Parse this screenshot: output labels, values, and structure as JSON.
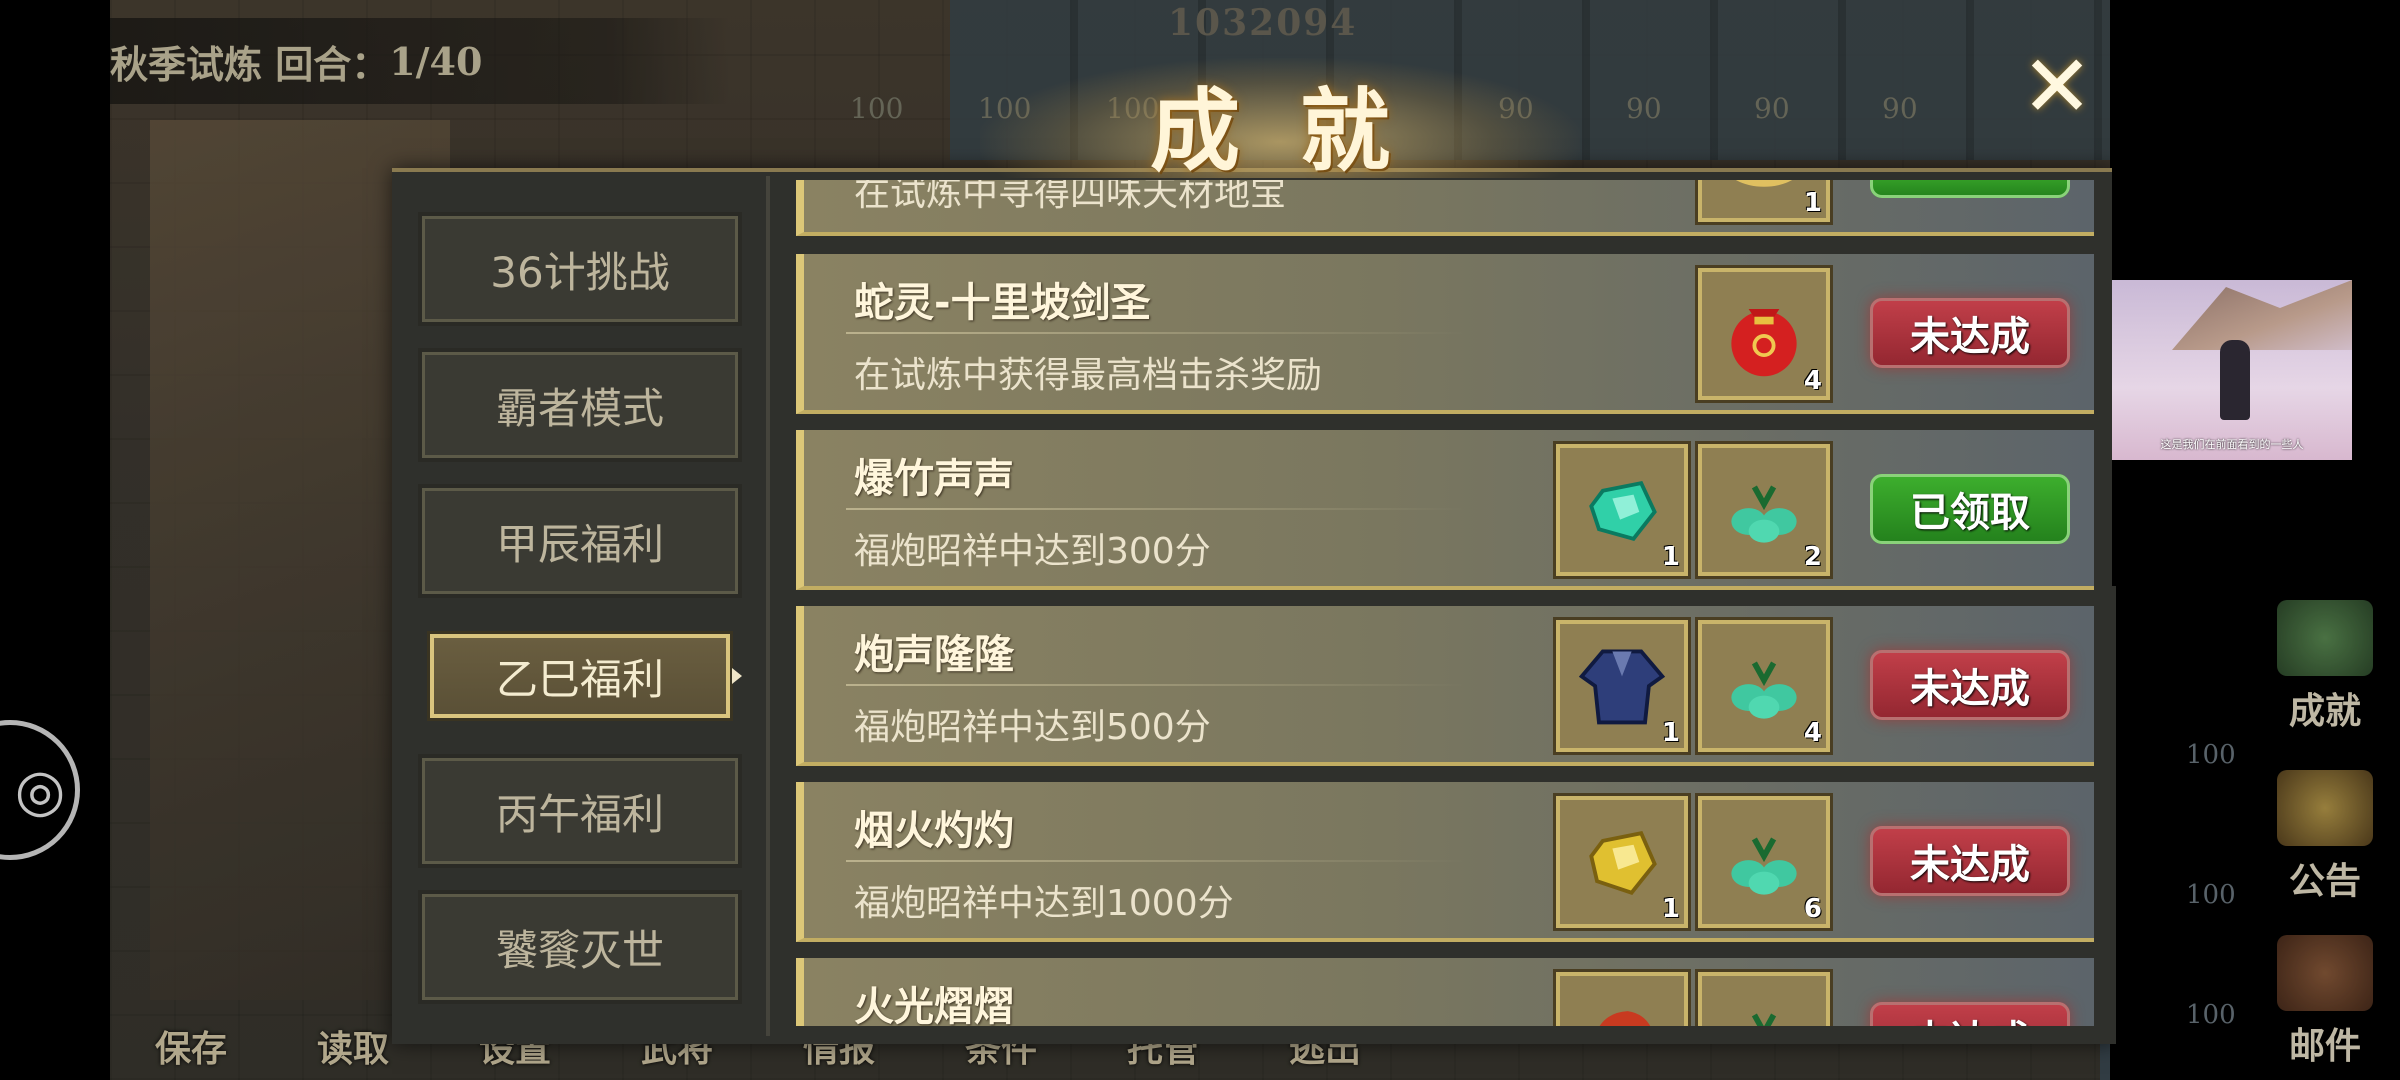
{
  "hud": {
    "round_label": "秋季试炼 回合：",
    "round_value": "1/40",
    "score": "1032094",
    "grid_numbers": [
      "100",
      "100",
      "100",
      "90",
      "90",
      "90",
      "90"
    ],
    "right_numbers": [
      "100",
      "100",
      "100"
    ]
  },
  "bottom_menu": [
    "保存",
    "读取",
    "设置",
    "武将",
    "情报",
    "条件",
    "托管",
    "逃出"
  ],
  "side_buttons": {
    "achievement": "成就",
    "notice": "公告",
    "mail": "邮件"
  },
  "panel": {
    "title": "成就",
    "close_icon": "close-icon"
  },
  "tabs": [
    {
      "label": "36计挑战",
      "active": false
    },
    {
      "label": "霸者模式",
      "active": false
    },
    {
      "label": "甲辰福利",
      "active": false
    },
    {
      "label": "乙巳福利",
      "active": true
    },
    {
      "label": "丙午福利",
      "active": false
    },
    {
      "label": "饕餮灭世",
      "active": false
    }
  ],
  "achievements": [
    {
      "name": "",
      "desc": "在试炼中寻得四味天材地宝",
      "rewards": [
        {
          "icon": "treasure-icon",
          "qty": "1"
        }
      ],
      "status": "",
      "status_color": "#3eb02e"
    },
    {
      "name": "蛇灵-十里坡剑圣",
      "desc": "在试炼中获得最高档击杀奖励",
      "rewards": [
        {
          "icon": "red-pouch-icon",
          "qty": "4"
        }
      ],
      "status": "未达成",
      "status_color": "#b3343d"
    },
    {
      "name": "爆竹声声",
      "desc": "福炮昭祥中达到300分",
      "rewards": [
        {
          "icon": "jade-gem-icon",
          "qty": "1"
        },
        {
          "icon": "jade-knot-icon",
          "qty": "2"
        }
      ],
      "status": "已领取",
      "status_color": "#2f9a24"
    },
    {
      "name": "炮声隆隆",
      "desc": "福炮昭祥中达到500分",
      "rewards": [
        {
          "icon": "blue-robe-icon",
          "qty": "1"
        },
        {
          "icon": "jade-knot-icon",
          "qty": "4"
        }
      ],
      "status": "未达成",
      "status_color": "#b3343d"
    },
    {
      "name": "烟火灼灼",
      "desc": "福炮昭祥中达到1000分",
      "rewards": [
        {
          "icon": "gold-gem-icon",
          "qty": "1"
        },
        {
          "icon": "jade-knot-icon",
          "qty": "6"
        }
      ],
      "status": "未达成",
      "status_color": "#b3343d"
    },
    {
      "name": "火光熠熠",
      "desc": "",
      "rewards": [
        {
          "icon": "red-helmet-icon",
          "qty": ""
        },
        {
          "icon": "jade-knot-icon",
          "qty": ""
        }
      ],
      "status": "未达成",
      "status_color": "#b3343d"
    }
  ],
  "video": {
    "caption": "这是我们在前面看到的一些人"
  }
}
